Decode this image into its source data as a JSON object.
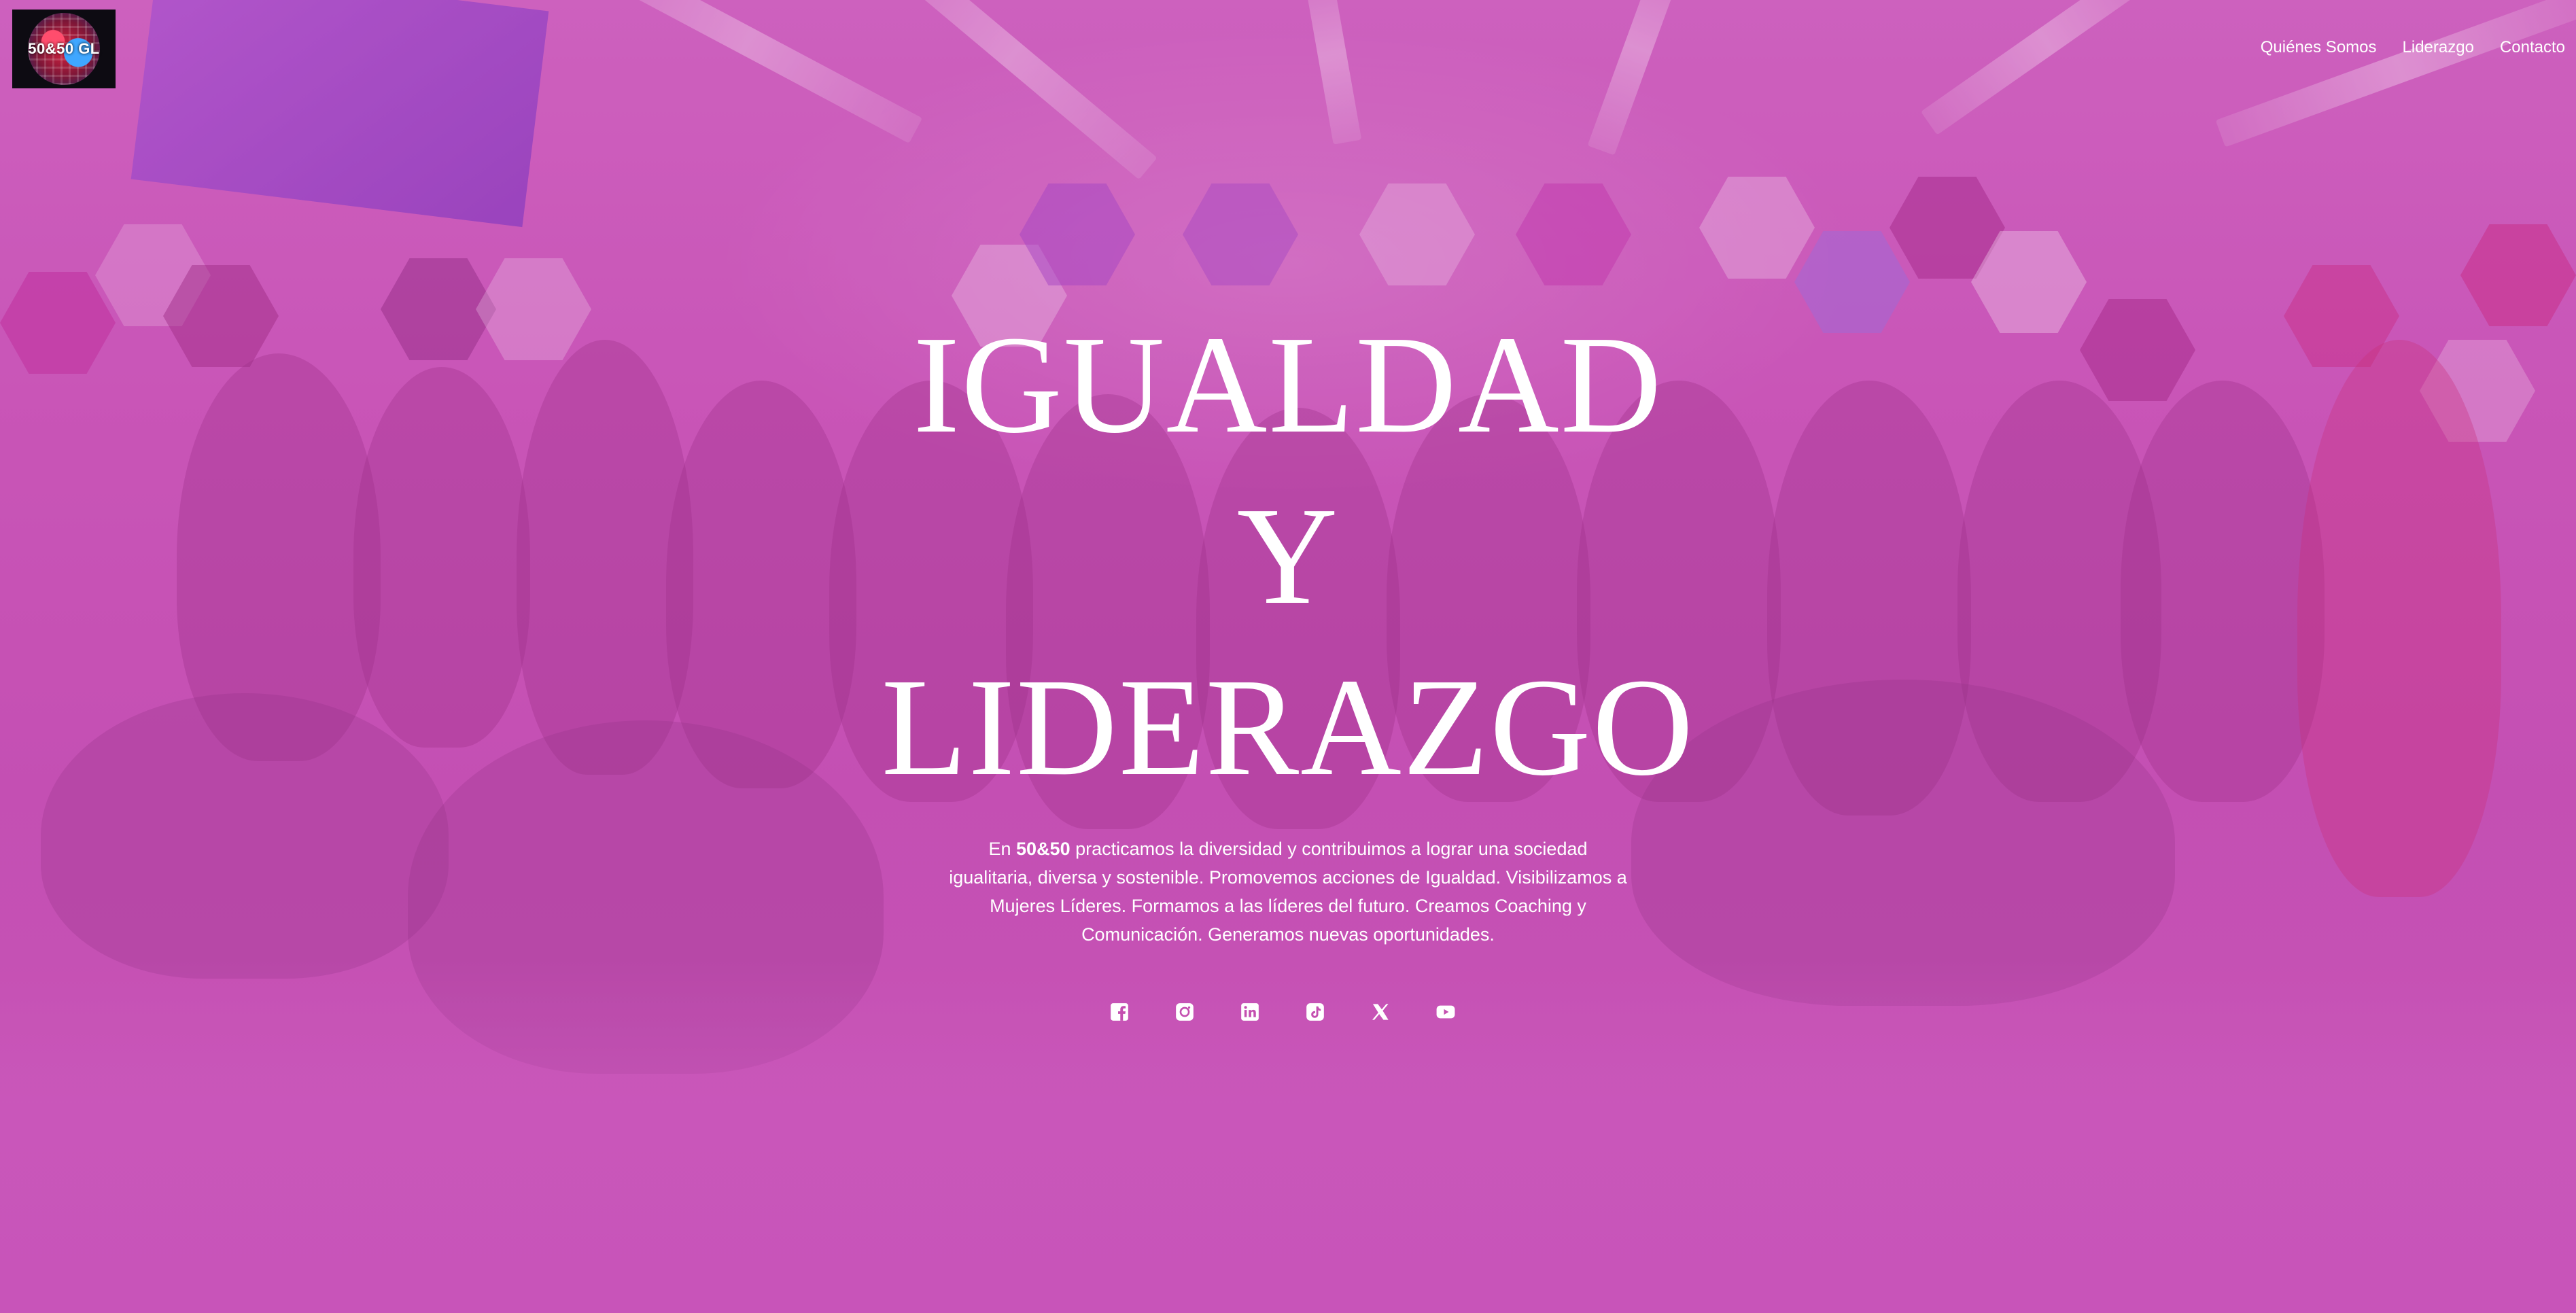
{
  "header": {
    "logo_text": "50&50 GL",
    "nav": [
      {
        "label": "Quiénes Somos"
      },
      {
        "label": "Liderazgo"
      },
      {
        "label": "Contacto"
      }
    ]
  },
  "hero": {
    "title_line1": "IGUALDAD",
    "title_line2": "Y",
    "title_line3": "LIDERAZGO",
    "description_prefix": "En ",
    "description_brand": "50&50",
    "description_rest": " practicamos la diversidad y contribuimos a lograr una sociedad igualitaria, diversa y sostenible. Promovemos acciones de Igualdad. Visibilizamos a Mujeres Líderes. Formamos a las líderes del futuro. Creamos Coaching y Comunicación. Generamos nuevas oportunidades."
  },
  "social": [
    {
      "icon": "facebook-icon"
    },
    {
      "icon": "instagram-icon"
    },
    {
      "icon": "linkedin-icon"
    },
    {
      "icon": "tiktok-icon"
    },
    {
      "icon": "x-icon"
    },
    {
      "icon": "youtube-icon"
    }
  ],
  "colors": {
    "overlay": "#c44fb0",
    "text": "#ffffff"
  }
}
